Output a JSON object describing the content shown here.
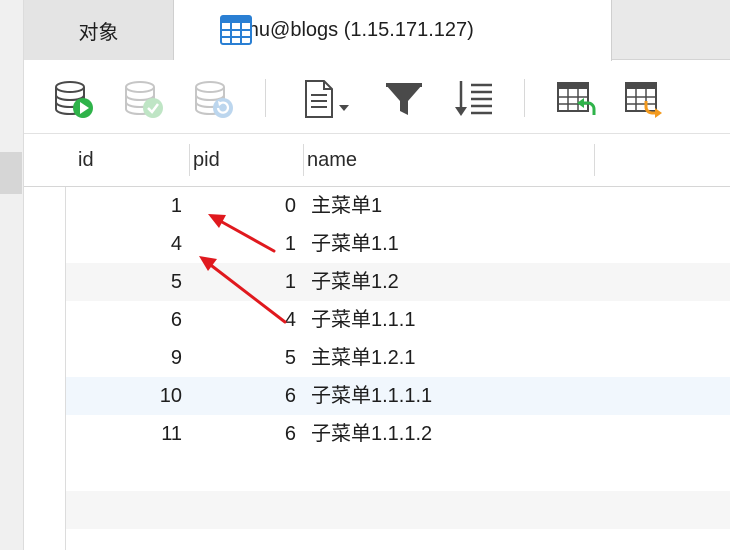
{
  "tabs": [
    {
      "label": "对象"
    },
    {
      "label": "menu@blogs (1.15.171.127)"
    }
  ],
  "toolbar": {
    "icons": [
      "begin-transaction-icon",
      "commit-icon",
      "rollback-icon",
      "text-view-icon",
      "filter-icon",
      "sort-icon",
      "import-icon",
      "export-icon"
    ]
  },
  "columns": [
    "id",
    "pid",
    "name"
  ],
  "rows": [
    {
      "id": "1",
      "pid": "0",
      "name": "主菜单1"
    },
    {
      "id": "4",
      "pid": "1",
      "name": "子菜单1.1"
    },
    {
      "id": "5",
      "pid": "1",
      "name": "子菜单1.2"
    },
    {
      "id": "6",
      "pid": "4",
      "name": "子菜单1.1.1"
    },
    {
      "id": "9",
      "pid": "5",
      "name": "主菜单1.2.1"
    },
    {
      "id": "10",
      "pid": "6",
      "name": "子菜单1.1.1.1"
    },
    {
      "id": "11",
      "pid": "6",
      "name": "子菜单1.1.1.2"
    }
  ],
  "annotation_color": "#e0191e"
}
